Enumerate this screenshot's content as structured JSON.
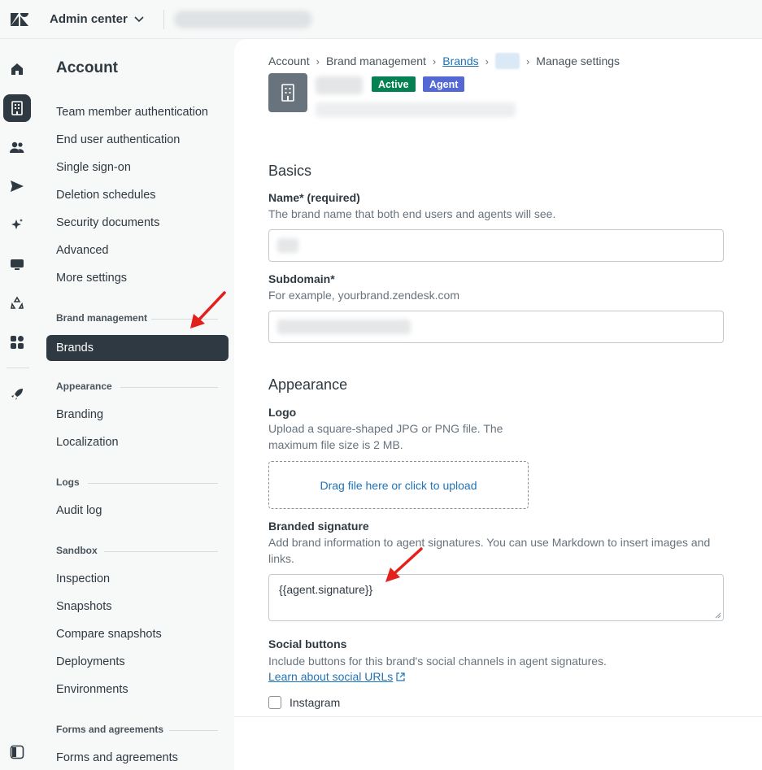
{
  "header": {
    "product_label": "Admin center"
  },
  "sidebar": {
    "title": "Account",
    "items": [
      {
        "label": "Team member authentication"
      },
      {
        "label": "End user authentication"
      },
      {
        "label": "Single sign-on"
      },
      {
        "label": "Deletion schedules"
      },
      {
        "label": "Security documents"
      },
      {
        "label": "Advanced"
      },
      {
        "label": "More settings"
      }
    ],
    "sections": {
      "brand_management": {
        "title": "Brand management",
        "items": [
          "Brands"
        ]
      },
      "appearance": {
        "title": "Appearance",
        "items": [
          "Branding",
          "Localization"
        ]
      },
      "logs": {
        "title": "Logs",
        "items": [
          "Audit log"
        ]
      },
      "sandbox": {
        "title": "Sandbox",
        "items": [
          "Inspection",
          "Snapshots",
          "Compare snapshots",
          "Deployments",
          "Environments"
        ]
      },
      "forms": {
        "title": "Forms and agreements",
        "items": [
          "Forms and agreements"
        ]
      }
    }
  },
  "breadcrumb": {
    "account": "Account",
    "brand_management": "Brand management",
    "brands": "Brands",
    "current": "Manage settings"
  },
  "brand": {
    "status_badge": "Active",
    "type_badge": "Agent"
  },
  "form": {
    "basics_heading": "Basics",
    "name_label": "Name* (required)",
    "name_hint": "The brand name that both end users and agents will see.",
    "subdomain_label": "Subdomain*",
    "subdomain_hint": "For example, yourbrand.zendesk.com",
    "appearance_heading": "Appearance",
    "logo_label": "Logo",
    "logo_hint_1": "Upload a square-shaped JPG or PNG file. The",
    "logo_hint_2": "maximum file size is 2 MB.",
    "upload_text": "Drag file here or click to upload",
    "signature_label": "Branded signature",
    "signature_hint_1": "Add brand information to agent signatures. You can use Markdown to insert images and",
    "signature_hint_2": "links.",
    "signature_value": "{{agent.signature}}",
    "social_label": "Social buttons",
    "social_hint": "Include buttons for this brand's social channels in agent signatures.",
    "social_link": "Learn about social URLs",
    "instagram_label": "Instagram"
  },
  "colors": {
    "accent_link": "#1f73b7",
    "active_badge": "#038153",
    "agent_badge": "#5468d4",
    "nav_active": "#2f3941",
    "annotation_arrow": "#e3201b"
  },
  "icons": [
    "zendesk-logo-icon",
    "chevron-down-icon",
    "home-icon",
    "building-icon",
    "people-icon",
    "send-icon",
    "sparkle-icon",
    "monitor-icon",
    "recycle-icon",
    "apps-icon",
    "rocket-icon",
    "sidebar-toggle-icon",
    "external-link-icon"
  ]
}
